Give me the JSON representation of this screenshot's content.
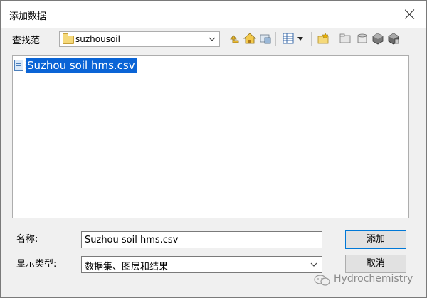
{
  "dialog": {
    "title": "添加数据",
    "close_icon": "close-icon"
  },
  "lookin": {
    "label": "查找范",
    "value": "suzhousoil",
    "folder_icon": "folder-icon",
    "arrow_icon": "chevron-down-icon"
  },
  "toolbar": {
    "icons": [
      "up-one-level-icon",
      "home-icon",
      "recent-location-icon",
      "view-list-icon",
      "view-dropdown-icon",
      "connect-folder-icon",
      "new-folder-icon",
      "toolbox-icon",
      "database-icon",
      "catalog-icon"
    ]
  },
  "files": [
    {
      "name": "Suzhou soil hms.csv",
      "icon": "csv-file-icon",
      "selected": true
    }
  ],
  "form": {
    "name_label": "名称:",
    "name_value": "Suzhou soil hms.csv",
    "type_label": "显示类型:",
    "type_value": "数据集、图层和结果"
  },
  "buttons": {
    "add": "添加",
    "cancel": "取消"
  },
  "watermark": {
    "text": "Hydrochemistry",
    "icon": "wechat-icon"
  },
  "colors": {
    "selection": "#0a64d6",
    "dialog_bg": "#f0f0f0",
    "default_button_border": "#0078d7"
  }
}
